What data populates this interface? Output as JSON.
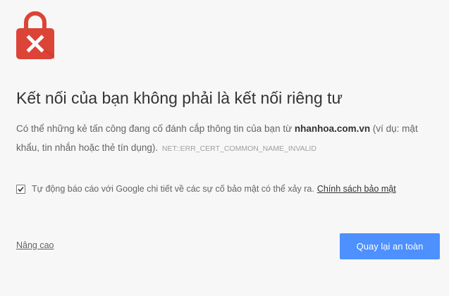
{
  "error_page": {
    "title": "Kết nối của bạn không phải là kết nối riêng tư",
    "description_prefix": "Có thể những kẻ tấn công đang cố đánh cắp thông tin của bạn từ",
    "hostname": "nhanhoa.com.vn",
    "description_suffix": "(ví dụ: mật khẩu, tin nhắn hoặc thẻ tín dụng).",
    "error_code": "NET::ERR_CERT_COMMON_NAME_INVALID",
    "report_checkbox": {
      "checked": true,
      "label": "Tự động báo cáo với Google chi tiết về các sự cố bảo mật có thể xảy ra.",
      "link_label": "Chính sách bảo mật"
    },
    "advanced_label": "Nâng cao",
    "back_button_label": "Quay lại an toàn",
    "icon": "lock-error-icon",
    "colors": {
      "lock": "#db4437",
      "button": "#4d90fe",
      "background": "#f7f7f7"
    }
  }
}
